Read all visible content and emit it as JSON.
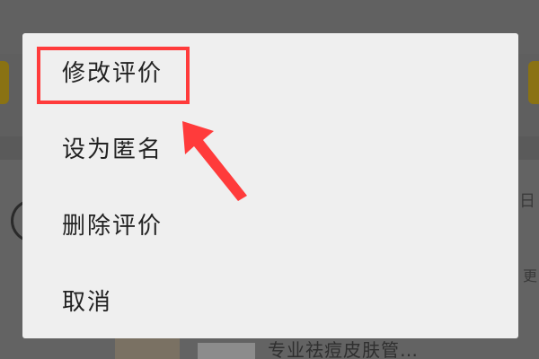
{
  "background": {
    "date_fragment": "日",
    "more_fragment": "更",
    "product_title": "专业祛痘皮肤管…"
  },
  "menu": {
    "items": [
      {
        "label": "修改评价"
      },
      {
        "label": "设为匿名"
      },
      {
        "label": "删除评价"
      },
      {
        "label": "取消"
      }
    ]
  },
  "annotation": {
    "color": "#ff3b3b",
    "target": "修改评价"
  }
}
